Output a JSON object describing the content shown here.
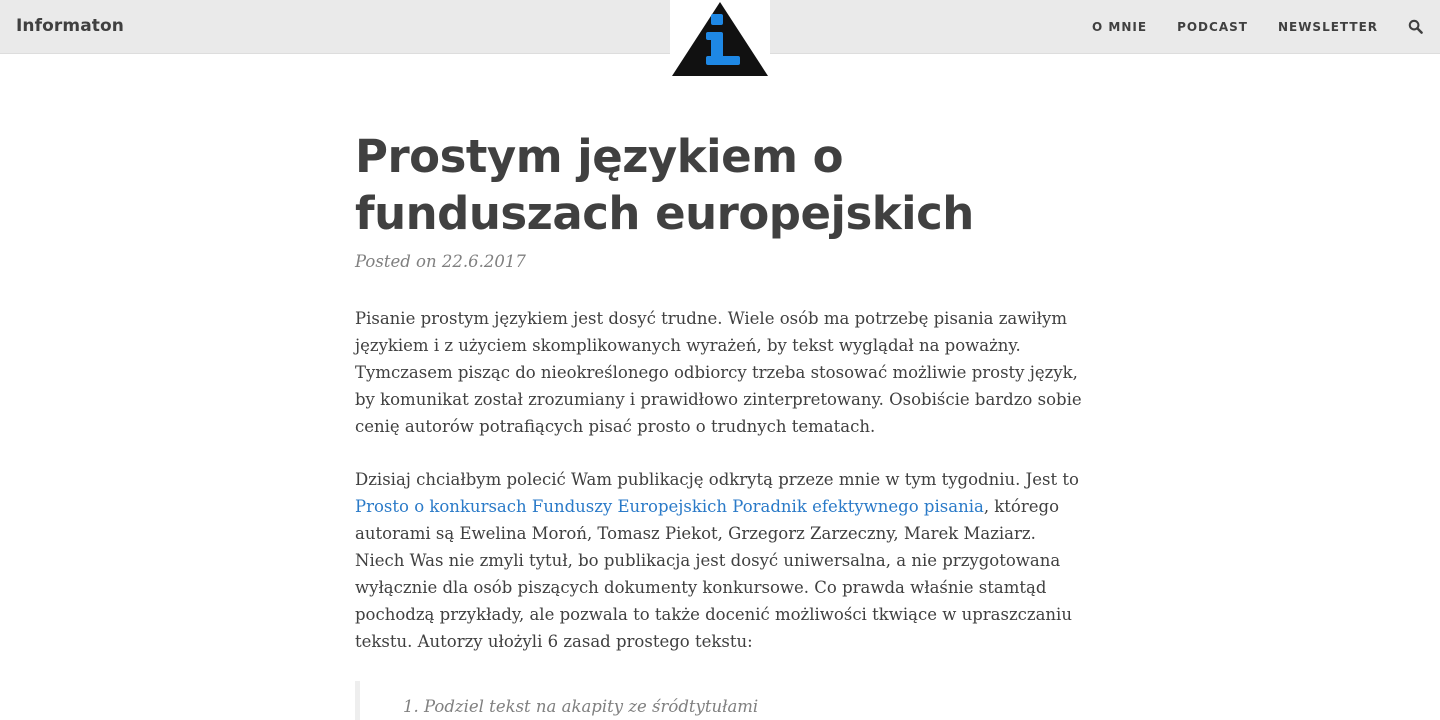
{
  "site": {
    "brand": "Informaton"
  },
  "nav": {
    "items": [
      "O MNIE",
      "PODCAST",
      "NEWSLETTER"
    ],
    "search_icon": "search-icon"
  },
  "logo": {
    "icon": "info-triangle-icon",
    "colors": {
      "triangle": "#111111",
      "glyph": "#1e88e5"
    }
  },
  "post": {
    "title": "Prostym językiem o funduszach europejskich",
    "meta": "Posted on 22.6.2017",
    "paragraph1": "Pisanie prostym językiem jest dosyć trudne. Wiele osób ma potrzebę pisania zawiłym językiem i z użyciem skomplikowanych wyrażeń, by tekst wyglądał na poważny. Tymczasem pisząc do nieokreślonego odbiorcy trzeba stosować możliwie prosty język, by komunikat został zrozumiany i prawidłowo zinterpretowany. Osobiście bardzo sobie cenię autorów potrafiących pisać prosto o trudnych tematach.",
    "paragraph2_before": "Dzisiaj chciałbym polecić Wam publikację odkrytą przeze mnie w tym tygodniu. Jest to ",
    "paragraph2_link": "Prosto o konkursach Funduszy Europejskich Poradnik efektywnego pisania",
    "paragraph2_after": ", którego autorami są Ewelina Moroń, Tomasz Piekot, Grzegorz Zarzeczny, Marek Maziarz. Niech Was nie zmyli tytuł, bo publikacja jest dosyć uniwersalna, a nie przygotowana wyłącznie dla osób piszących dokumenty konkursowe. Co prawda właśnie stamtąd pochodzą przykłady, ale pozwala to także docenić możliwości tkwiące w upraszczaniu tekstu. Autorzy ułożyli 6 zasad prostego tekstu:",
    "rules": [
      "Podziel tekst na akapity ze śródtytułami"
    ]
  },
  "colors": {
    "topbar_bg": "#eaeaea",
    "text": "#404040",
    "meta": "#808080",
    "link": "#2a7ac8"
  }
}
